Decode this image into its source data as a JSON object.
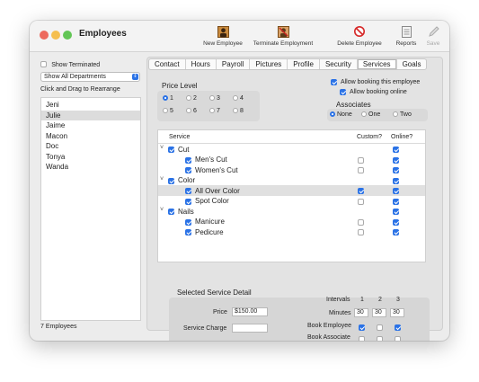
{
  "window": {
    "title": "Employees"
  },
  "toolbar": {
    "new_employee": "New Employee",
    "terminate_employment": "Terminate Employment",
    "delete_employee": "Delete Employee",
    "reports": "Reports",
    "save": "Save"
  },
  "sidebar": {
    "show_terminated_label": "Show Terminated",
    "show_terminated_checked": false,
    "department_select": "Show All Departments",
    "rearrange_hint": "Click and Drag to Rearrange",
    "employees": [
      "Jeni",
      "Julie",
      "Jaime",
      "Macon",
      "Doc",
      "Tonya",
      "Wanda"
    ],
    "selected_employee": "Julie",
    "count_label": "7 Employees"
  },
  "tabs": [
    "Contact",
    "Hours",
    "Payroll",
    "Pictures",
    "Profile",
    "Security",
    "Services",
    "Goals"
  ],
  "active_tab": "Services",
  "price_level": {
    "label": "Price Level",
    "options": [
      "1",
      "2",
      "3",
      "4",
      "5",
      "6",
      "7",
      "8"
    ],
    "selected": "1"
  },
  "booking": {
    "allow_booking_employee": "Allow booking this employee",
    "allow_booking_online": "Allow booking online"
  },
  "associates": {
    "label": "Associates",
    "options": [
      "None",
      "One",
      "Two"
    ],
    "selected": "None"
  },
  "services_table": {
    "col_service": "Service",
    "col_custom": "Custom?",
    "col_online": "Online?",
    "rows": [
      {
        "name": "Cut",
        "level": 0,
        "checked": true,
        "custom": null,
        "online": true
      },
      {
        "name": "Men's Cut",
        "level": 1,
        "checked": true,
        "custom": false,
        "online": true
      },
      {
        "name": "Women's Cut",
        "level": 1,
        "checked": true,
        "custom": false,
        "online": true
      },
      {
        "name": "Color",
        "level": 0,
        "checked": true,
        "custom": null,
        "online": true
      },
      {
        "name": "All Over Color",
        "level": 1,
        "checked": true,
        "custom": true,
        "online": true,
        "selected": true
      },
      {
        "name": "Spot Color",
        "level": 1,
        "checked": true,
        "custom": false,
        "online": true
      },
      {
        "name": "Nails",
        "level": 0,
        "checked": true,
        "custom": null,
        "online": true
      },
      {
        "name": "Manicure",
        "level": 1,
        "checked": true,
        "custom": false,
        "online": true
      },
      {
        "name": "Pedicure",
        "level": 1,
        "checked": true,
        "custom": false,
        "online": true
      }
    ]
  },
  "detail": {
    "title": "Selected Service Detail",
    "price_label": "Price",
    "price_value": "$150.00",
    "service_charge_label": "Service Charge",
    "service_charge_value": "",
    "intervals_label": "Intervals",
    "interval_headers": [
      "1",
      "2",
      "3"
    ],
    "minutes_label": "Minutes",
    "minutes": [
      "30",
      "30",
      "30"
    ],
    "book_employee_label": "Book Employee",
    "book_employee": [
      true,
      false,
      true
    ],
    "book_associate_label": "Book Associate",
    "book_associate": [
      false,
      false,
      false
    ]
  },
  "colors": {
    "accent": "#2a72e6",
    "red_light": "#ed6a5e",
    "yellow_light": "#f5bf4f",
    "green_light": "#61c554"
  }
}
